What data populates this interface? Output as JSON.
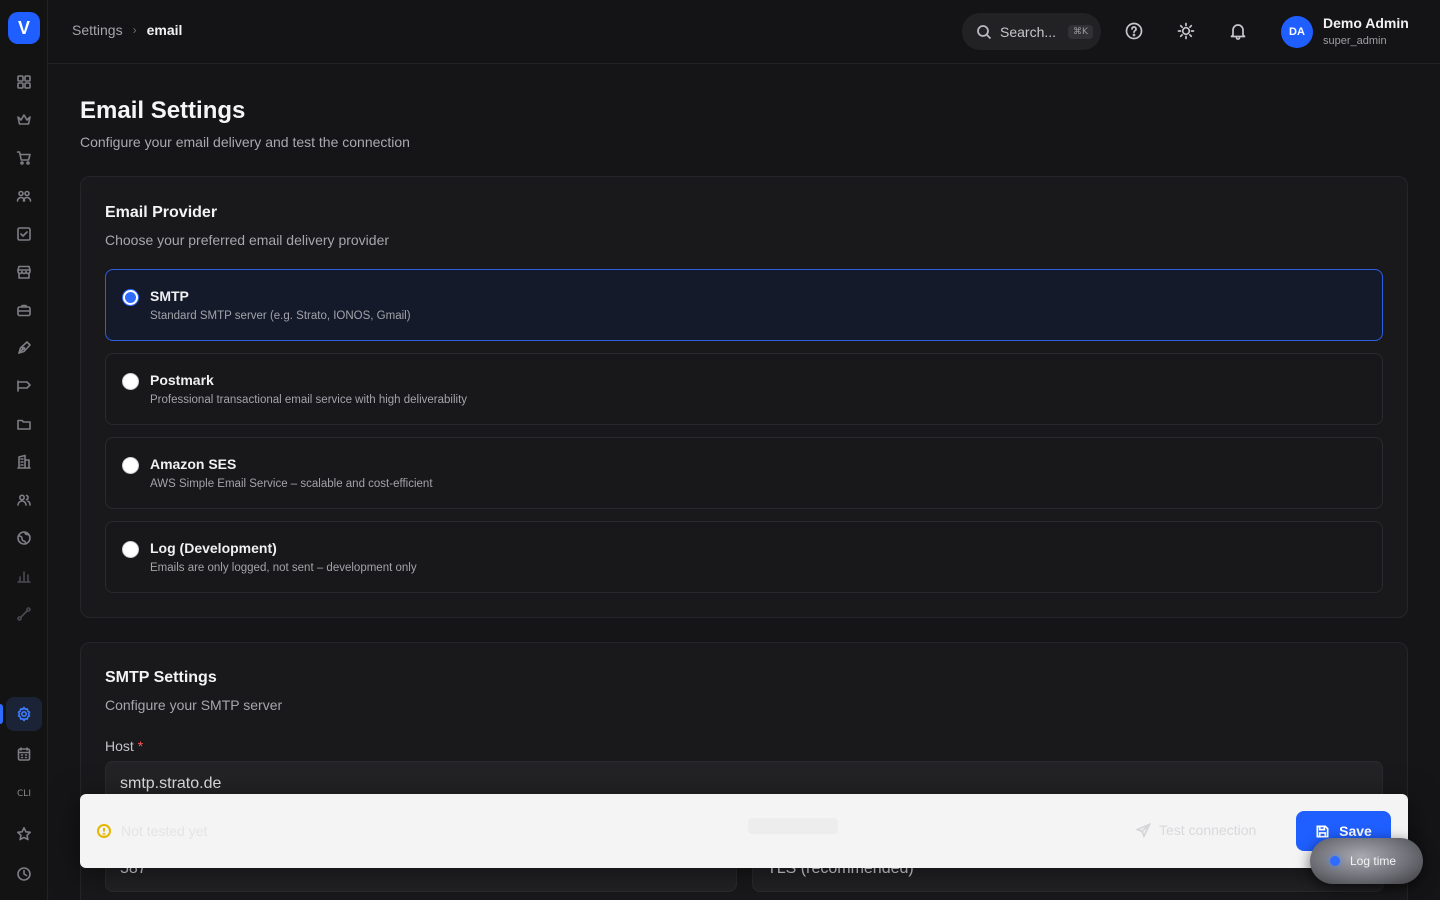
{
  "app": {
    "logo_letter": "V"
  },
  "sidebar": {
    "cli_label": "CLI",
    "icons": [
      "dashboard-icon",
      "crown-icon",
      "cart-icon",
      "users-icon",
      "task-check-icon",
      "store-icon",
      "briefcase-icon",
      "pen-tool-icon",
      "megaphone-icon",
      "folder-icon",
      "building-icon",
      "team-icon",
      "globe-icon",
      "bar-chart-icon",
      "route-icon",
      "settings-icon",
      "calendar-icon",
      "cli-icon",
      "star-icon",
      "clock-icon"
    ],
    "active": "settings-icon"
  },
  "topbar": {
    "breadcrumb": {
      "parent": "Settings",
      "current": "email"
    },
    "search": {
      "placeholder": "Search...",
      "shortcut": "⌘K"
    },
    "user": {
      "initials": "DA",
      "name": "Demo Admin",
      "role": "super_admin"
    }
  },
  "page": {
    "title": "Email Settings",
    "subtitle": "Configure your email delivery and test the connection"
  },
  "provider_card": {
    "title": "Email Provider",
    "subtitle": "Choose your preferred email delivery provider",
    "options": [
      {
        "title": "SMTP",
        "description": "Standard SMTP server (e.g. Strato, IONOS, Gmail)",
        "selected": true
      },
      {
        "title": "Postmark",
        "description": "Professional transactional email service with high deliverability",
        "selected": false
      },
      {
        "title": "Amazon SES",
        "description": "AWS Simple Email Service – scalable and cost-efficient",
        "selected": false
      },
      {
        "title": "Log (Development)",
        "description": "Emails are only logged, not sent – development only",
        "selected": false
      }
    ]
  },
  "smtp_card": {
    "title": "SMTP Settings",
    "subtitle": "Configure your SMTP server",
    "host_label": "Host",
    "required_mark": "*",
    "host_value": "smtp.strato.de",
    "port_value": "587",
    "encryption_value": "TLS (recommended)"
  },
  "actionbar": {
    "status": "Not tested yet",
    "test_label": "Test connection",
    "save_label": "Save"
  },
  "log_time": {
    "label": "Log time"
  },
  "colors": {
    "accent": "#1f5fff",
    "background": "#151517",
    "warning": "#e5b600",
    "required": "#ff5a5a"
  }
}
